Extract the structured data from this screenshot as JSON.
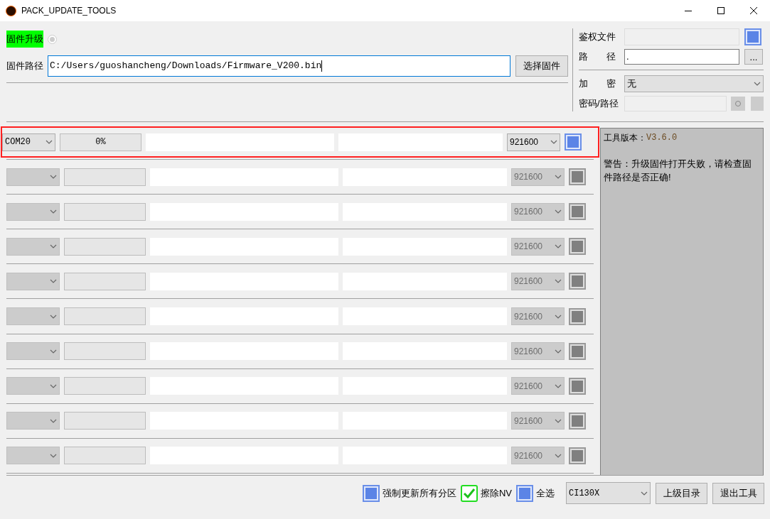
{
  "window": {
    "title": "PACK_UPDATE_TOOLS"
  },
  "firmware": {
    "mode_label": "固件升级",
    "mode_selected": true,
    "path_label": "固件路径",
    "path_value": "C:/Users/guoshancheng/Downloads/Firmware_V200.bin",
    "select_button": "选择固件"
  },
  "auth": {
    "file_label": "鉴权文件",
    "file_checked": false,
    "path_label": "路　　径",
    "path_value": ".",
    "browse_button": "...",
    "encrypt_label": "加　　密",
    "encrypt_value": "无",
    "password_label": "密码/路径"
  },
  "ports": [
    {
      "port": "COM20",
      "progress": "0%",
      "level": 0,
      "baud": "921600",
      "enabled": true,
      "highlighted": true,
      "checked": false
    },
    {
      "level": 0,
      "baud": "921600",
      "enabled": false,
      "highlighted": false,
      "checked": false
    },
    {
      "level": 0,
      "baud": "921600",
      "enabled": false,
      "highlighted": false,
      "checked": false
    },
    {
      "level": 0,
      "baud": "921600",
      "enabled": false,
      "highlighted": false,
      "checked": false
    },
    {
      "level": 0,
      "baud": "921600",
      "enabled": false,
      "highlighted": false,
      "checked": false
    },
    {
      "level": 0,
      "baud": "921600",
      "enabled": false,
      "highlighted": false,
      "checked": false
    },
    {
      "level": 0,
      "baud": "921600",
      "enabled": false,
      "highlighted": false,
      "checked": false
    },
    {
      "level": 0,
      "baud": "921600",
      "enabled": false,
      "highlighted": false,
      "checked": false
    },
    {
      "level": 0,
      "baud": "921600",
      "enabled": false,
      "highlighted": false,
      "checked": false
    },
    {
      "level": 0,
      "baud": "921600",
      "enabled": false,
      "highlighted": false,
      "checked": false
    }
  ],
  "log": {
    "version_label": "工具版本：",
    "version_value": "V3.6.0",
    "warning": "警告：升级固件打开失败，请检查固件路径是否正确!"
  },
  "footer": {
    "options": [
      {
        "label": "强制更新所有分区",
        "checked": false
      },
      {
        "label": "擦除NV",
        "checked": true
      },
      {
        "label": "全选",
        "checked": false
      }
    ],
    "chip": "CI130X",
    "buttons": [
      "上级目录",
      "退出工具"
    ]
  }
}
